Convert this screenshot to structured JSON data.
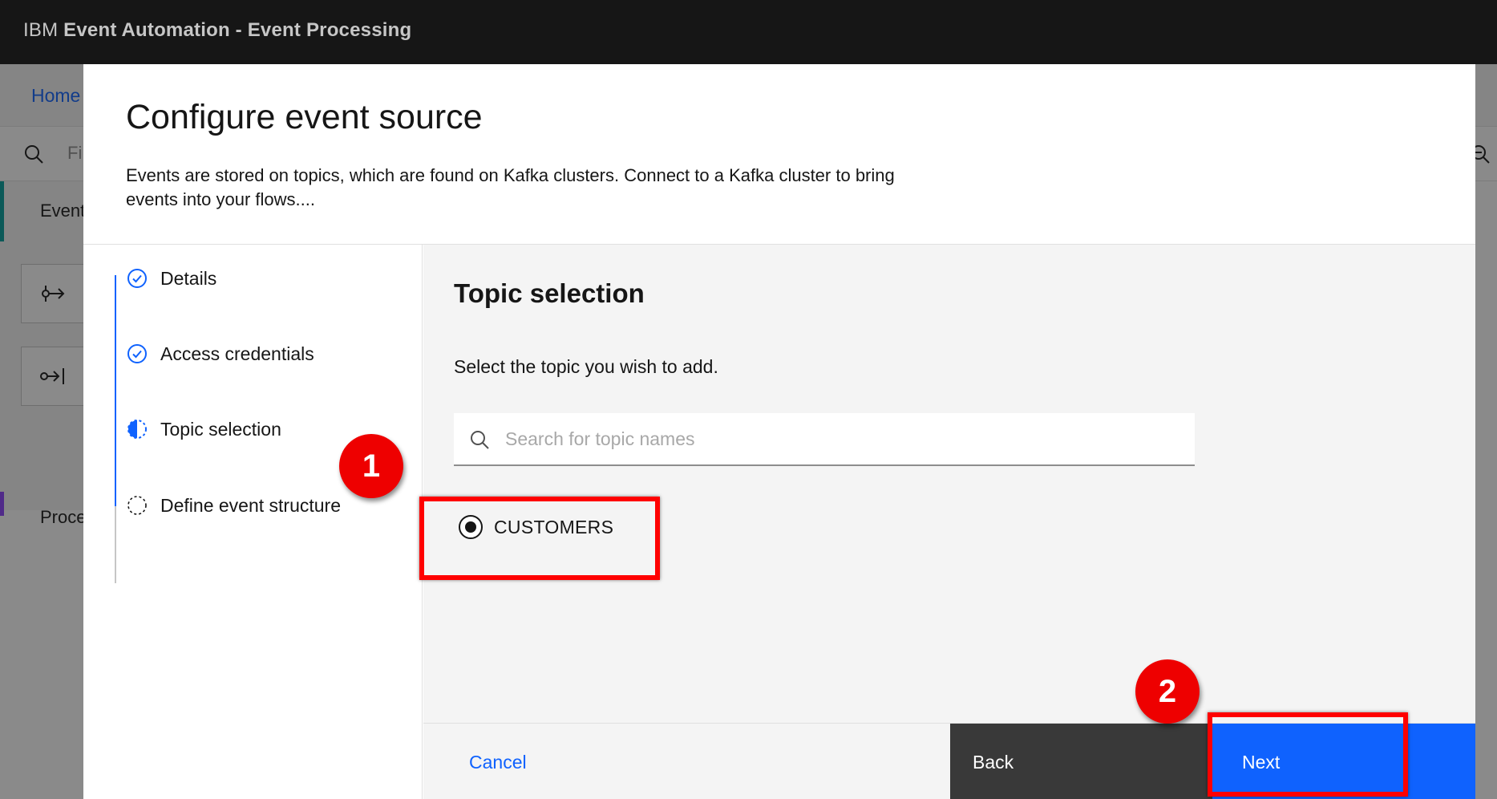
{
  "app": {
    "brand": "IBM",
    "product": "Event Automation - Event Processing"
  },
  "background": {
    "breadcrumb_home": "Home",
    "filter_placeholder": "Fi",
    "palette_events": "Event",
    "palette_processors": "Proce"
  },
  "modal": {
    "title": "Configure event source",
    "description": "Events are stored on topics, which are found on Kafka clusters. Connect to a Kafka cluster to bring events into your flows...."
  },
  "steps": [
    {
      "label": "Details",
      "state": "complete"
    },
    {
      "label": "Access credentials",
      "state": "complete"
    },
    {
      "label": "Topic selection",
      "state": "current"
    },
    {
      "label": "Define event structure",
      "state": "incomplete"
    }
  ],
  "content": {
    "title": "Topic selection",
    "subtitle": "Select the topic you wish to add.",
    "search_placeholder": "Search for topic names",
    "search_value": "",
    "topics": [
      {
        "name": "CUSTOMERS",
        "selected": true
      }
    ]
  },
  "footer": {
    "cancel": "Cancel",
    "back": "Back",
    "next": "Next"
  },
  "annotations": [
    {
      "number": "1",
      "target": "topic CUSTOMERS"
    },
    {
      "number": "2",
      "target": "Next button"
    }
  ],
  "colors": {
    "primary": "#0f62fe",
    "header_bg": "#161616",
    "back_button": "#393939",
    "annotation_red": "#ee0000"
  }
}
